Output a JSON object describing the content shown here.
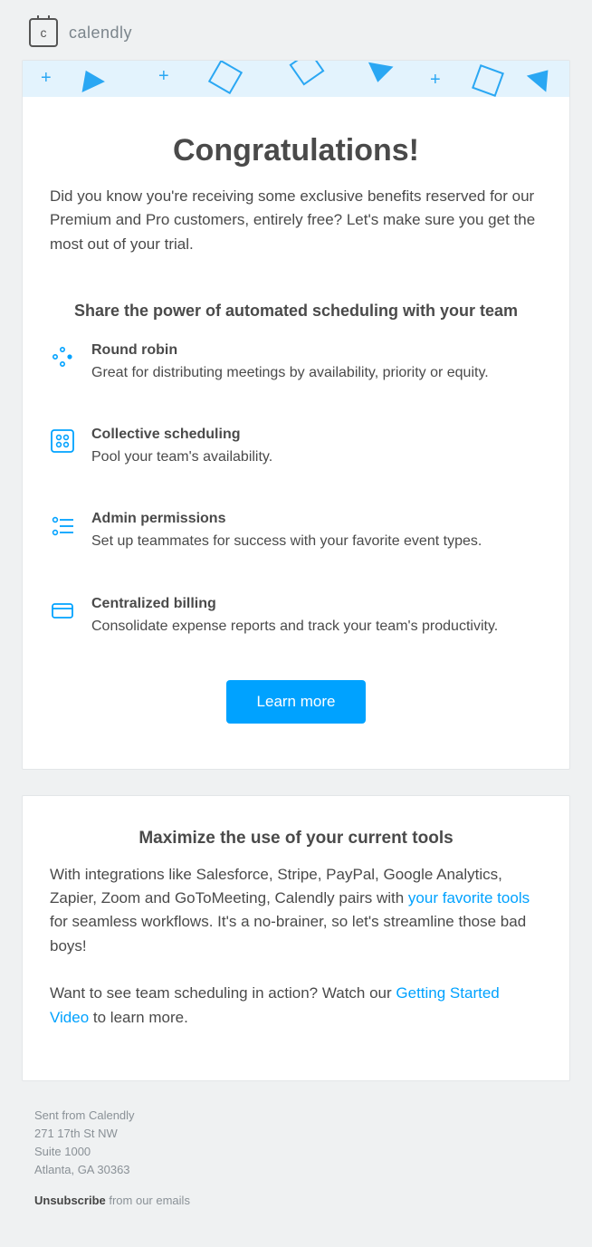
{
  "brand": {
    "name": "calendly",
    "logo_letter": "c"
  },
  "main": {
    "title": "Congratulations!",
    "intro": "Did you know you're receiving some exclusive benefits reserved for our Premium and Pro customers, entirely free? Let's make sure you get the most out of your trial.",
    "section_heading": "Share the power of automated scheduling with your team",
    "features": [
      {
        "title": "Round robin",
        "desc": "Great for distributing meetings by availability, priority or equity."
      },
      {
        "title": "Collective scheduling",
        "desc": "Pool your team's availability."
      },
      {
        "title": "Admin permissions",
        "desc": "Set up teammates for success with your favorite event types."
      },
      {
        "title": "Centralized billing",
        "desc": "Consolidate expense reports and track your team's productivity."
      }
    ],
    "cta_label": "Learn more"
  },
  "tools": {
    "heading": "Maximize the use of your current tools",
    "p1_a": "With integrations like Salesforce, Stripe, PayPal, Google Analytics, Zapier, Zoom and GoToMeeting, Calendly pairs with ",
    "p1_link": "your favorite tools",
    "p1_b": " for seamless workflows. It's a no-brainer, so let's streamline those bad boys!",
    "p2_a": "Want to see team scheduling in action? Watch our ",
    "p2_link": "Getting Started Video",
    "p2_b": " to learn more."
  },
  "footer": {
    "l1": "Sent from Calendly",
    "l2": "271 17th St NW",
    "l3": "Suite 1000",
    "l4": "Atlanta, GA 30363",
    "unsub": "Unsubscribe",
    "unsub_tail": " from our emails"
  },
  "icons": {
    "logo": "calendly-logo-icon",
    "round_robin": "round-robin-icon",
    "collective": "collective-icon",
    "admin": "admin-icon",
    "billing": "billing-icon"
  }
}
